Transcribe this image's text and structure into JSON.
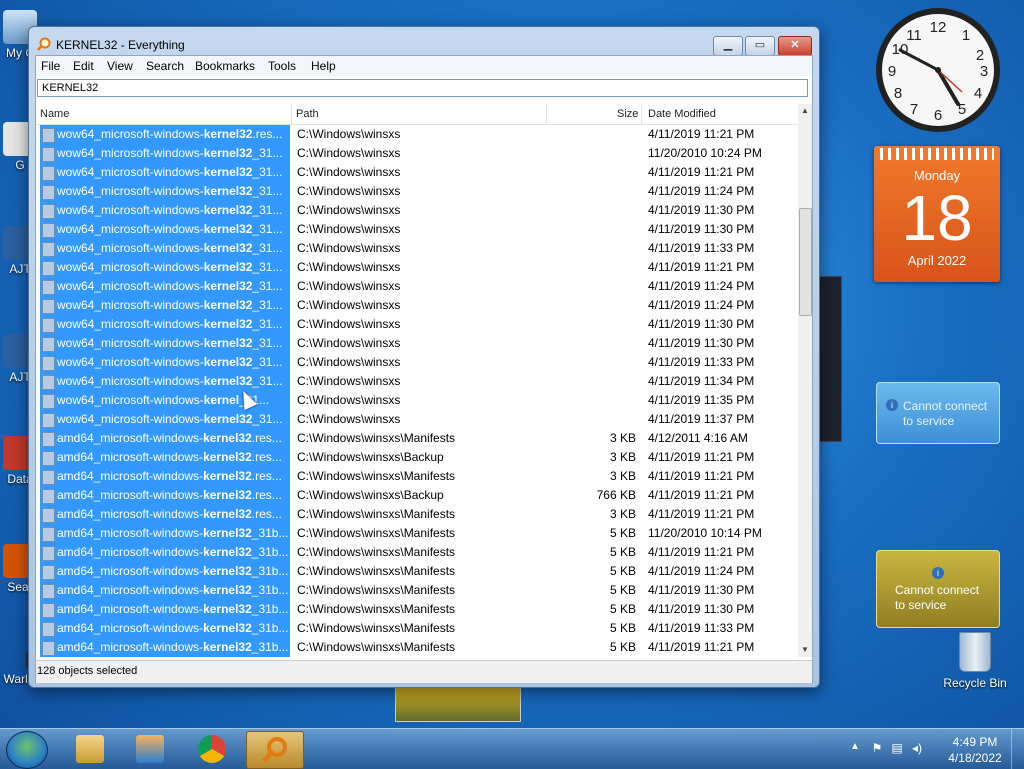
{
  "desktop": {
    "icons": [
      {
        "label": "My C"
      },
      {
        "label": "G"
      },
      {
        "label": "AJT"
      },
      {
        "label": "AJT"
      },
      {
        "label": "Data"
      },
      {
        "label": "Sear"
      },
      {
        "label": "Warl hunder"
      }
    ],
    "recycle_bin": "Recycle Bin"
  },
  "gadgets": {
    "calendar": {
      "day_of_week": "Monday",
      "day": "18",
      "month_year": "April 2022"
    },
    "weather_error_1": {
      "line1": "Cannot connect",
      "line2": "to service"
    },
    "weather_error_2": {
      "line1": "Cannot connect",
      "line2": "to service"
    }
  },
  "window": {
    "title": "KERNEL32 - Everything",
    "menu": [
      "File",
      "Edit",
      "View",
      "Search",
      "Bookmarks",
      "Tools",
      "Help"
    ],
    "search_value": "KERNEL32",
    "columns": {
      "name": "Name",
      "path": "Path",
      "size": "Size",
      "date": "Date Modified"
    },
    "rows": [
      {
        "prefix": "wow64_microsoft-windows-",
        "bold": "kernel32",
        "suffix": ".res...",
        "path": "C:\\Windows\\winsxs",
        "size": "",
        "date": "4/11/2019 11:21 PM"
      },
      {
        "prefix": "wow64_microsoft-windows-",
        "bold": "kernel32",
        "suffix": "_31...",
        "path": "C:\\Windows\\winsxs",
        "size": "",
        "date": "11/20/2010 10:24 PM"
      },
      {
        "prefix": "wow64_microsoft-windows-",
        "bold": "kernel32",
        "suffix": "_31...",
        "path": "C:\\Windows\\winsxs",
        "size": "",
        "date": "4/11/2019 11:21 PM"
      },
      {
        "prefix": "wow64_microsoft-windows-",
        "bold": "kernel32",
        "suffix": "_31...",
        "path": "C:\\Windows\\winsxs",
        "size": "",
        "date": "4/11/2019 11:24 PM"
      },
      {
        "prefix": "wow64_microsoft-windows-",
        "bold": "kernel32",
        "suffix": "_31...",
        "path": "C:\\Windows\\winsxs",
        "size": "",
        "date": "4/11/2019 11:30 PM"
      },
      {
        "prefix": "wow64_microsoft-windows-",
        "bold": "kernel32",
        "suffix": "_31...",
        "path": "C:\\Windows\\winsxs",
        "size": "",
        "date": "4/11/2019 11:30 PM"
      },
      {
        "prefix": "wow64_microsoft-windows-",
        "bold": "kernel32",
        "suffix": "_31...",
        "path": "C:\\Windows\\winsxs",
        "size": "",
        "date": "4/11/2019 11:33 PM"
      },
      {
        "prefix": "wow64_microsoft-windows-",
        "bold": "kernel32",
        "suffix": "_31...",
        "path": "C:\\Windows\\winsxs",
        "size": "",
        "date": "4/11/2019 11:21 PM"
      },
      {
        "prefix": "wow64_microsoft-windows-",
        "bold": "kernel32",
        "suffix": "_31...",
        "path": "C:\\Windows\\winsxs",
        "size": "",
        "date": "4/11/2019 11:24 PM"
      },
      {
        "prefix": "wow64_microsoft-windows-",
        "bold": "kernel32",
        "suffix": "_31...",
        "path": "C:\\Windows\\winsxs",
        "size": "",
        "date": "4/11/2019 11:24 PM"
      },
      {
        "prefix": "wow64_microsoft-windows-",
        "bold": "kernel32",
        "suffix": "_31...",
        "path": "C:\\Windows\\winsxs",
        "size": "",
        "date": "4/11/2019 11:30 PM"
      },
      {
        "prefix": "wow64_microsoft-windows-",
        "bold": "kernel32",
        "suffix": "_31...",
        "path": "C:\\Windows\\winsxs",
        "size": "",
        "date": "4/11/2019 11:30 PM"
      },
      {
        "prefix": "wow64_microsoft-windows-",
        "bold": "kernel32",
        "suffix": "_31...",
        "path": "C:\\Windows\\winsxs",
        "size": "",
        "date": "4/11/2019 11:33 PM"
      },
      {
        "prefix": "wow64_microsoft-windows-",
        "bold": "kernel32",
        "suffix": "_31...",
        "path": "C:\\Windows\\winsxs",
        "size": "",
        "date": "4/11/2019 11:34 PM"
      },
      {
        "prefix": "wow64_microsoft-windows-",
        "bold": "kernel",
        "suffix": "_31...",
        "path": "C:\\Windows\\winsxs",
        "size": "",
        "date": "4/11/2019 11:35 PM"
      },
      {
        "prefix": "wow64_microsoft-windows-",
        "bold": "kernel32",
        "suffix": "_31...",
        "path": "C:\\Windows\\winsxs",
        "size": "",
        "date": "4/11/2019 11:37 PM"
      },
      {
        "prefix": "amd64_microsoft-windows-",
        "bold": "kernel32",
        "suffix": ".res...",
        "path": "C:\\Windows\\winsxs\\Manifests",
        "size": "3 KB",
        "date": "4/12/2011 4:16 AM"
      },
      {
        "prefix": "amd64_microsoft-windows-",
        "bold": "kernel32",
        "suffix": ".res...",
        "path": "C:\\Windows\\winsxs\\Backup",
        "size": "3 KB",
        "date": "4/11/2019 11:21 PM"
      },
      {
        "prefix": "amd64_microsoft-windows-",
        "bold": "kernel32",
        "suffix": ".res...",
        "path": "C:\\Windows\\winsxs\\Manifests",
        "size": "3 KB",
        "date": "4/11/2019 11:21 PM"
      },
      {
        "prefix": "amd64_microsoft-windows-",
        "bold": "kernel32",
        "suffix": ".res...",
        "path": "C:\\Windows\\winsxs\\Backup",
        "size": "766 KB",
        "date": "4/11/2019 11:21 PM"
      },
      {
        "prefix": "amd64_microsoft-windows-",
        "bold": "kernel32",
        "suffix": ".res...",
        "path": "C:\\Windows\\winsxs\\Manifests",
        "size": "3 KB",
        "date": "4/11/2019 11:21 PM"
      },
      {
        "prefix": "amd64_microsoft-windows-",
        "bold": "kernel32",
        "suffix": "_31b...",
        "path": "C:\\Windows\\winsxs\\Manifests",
        "size": "5 KB",
        "date": "11/20/2010 10:14 PM"
      },
      {
        "prefix": "amd64_microsoft-windows-",
        "bold": "kernel32",
        "suffix": "_31b...",
        "path": "C:\\Windows\\winsxs\\Manifests",
        "size": "5 KB",
        "date": "4/11/2019 11:21 PM"
      },
      {
        "prefix": "amd64_microsoft-windows-",
        "bold": "kernel32",
        "suffix": "_31b...",
        "path": "C:\\Windows\\winsxs\\Manifests",
        "size": "5 KB",
        "date": "4/11/2019 11:24 PM"
      },
      {
        "prefix": "amd64_microsoft-windows-",
        "bold": "kernel32",
        "suffix": "_31b...",
        "path": "C:\\Windows\\winsxs\\Manifests",
        "size": "5 KB",
        "date": "4/11/2019 11:30 PM"
      },
      {
        "prefix": "amd64_microsoft-windows-",
        "bold": "kernel32",
        "suffix": "_31b...",
        "path": "C:\\Windows\\winsxs\\Manifests",
        "size": "5 KB",
        "date": "4/11/2019 11:30 PM"
      },
      {
        "prefix": "amd64_microsoft-windows-",
        "bold": "kernel32",
        "suffix": "_31b...",
        "path": "C:\\Windows\\winsxs\\Manifests",
        "size": "5 KB",
        "date": "4/11/2019 11:33 PM"
      },
      {
        "prefix": "amd64_microsoft-windows-",
        "bold": "kernel32",
        "suffix": "_31b...",
        "path": "C:\\Windows\\winsxs\\Manifests",
        "size": "5 KB",
        "date": "4/11/2019 11:21 PM"
      }
    ],
    "status": "128 objects selected"
  },
  "taskbar": {
    "clock_time": "4:49 PM",
    "clock_date": "4/18/2022",
    "apps": [
      "explorer-icon",
      "media-player-icon",
      "chrome-icon",
      "everything-search-icon"
    ]
  },
  "colors": {
    "selection": "#3399ff",
    "calendar": "#e8652a"
  }
}
